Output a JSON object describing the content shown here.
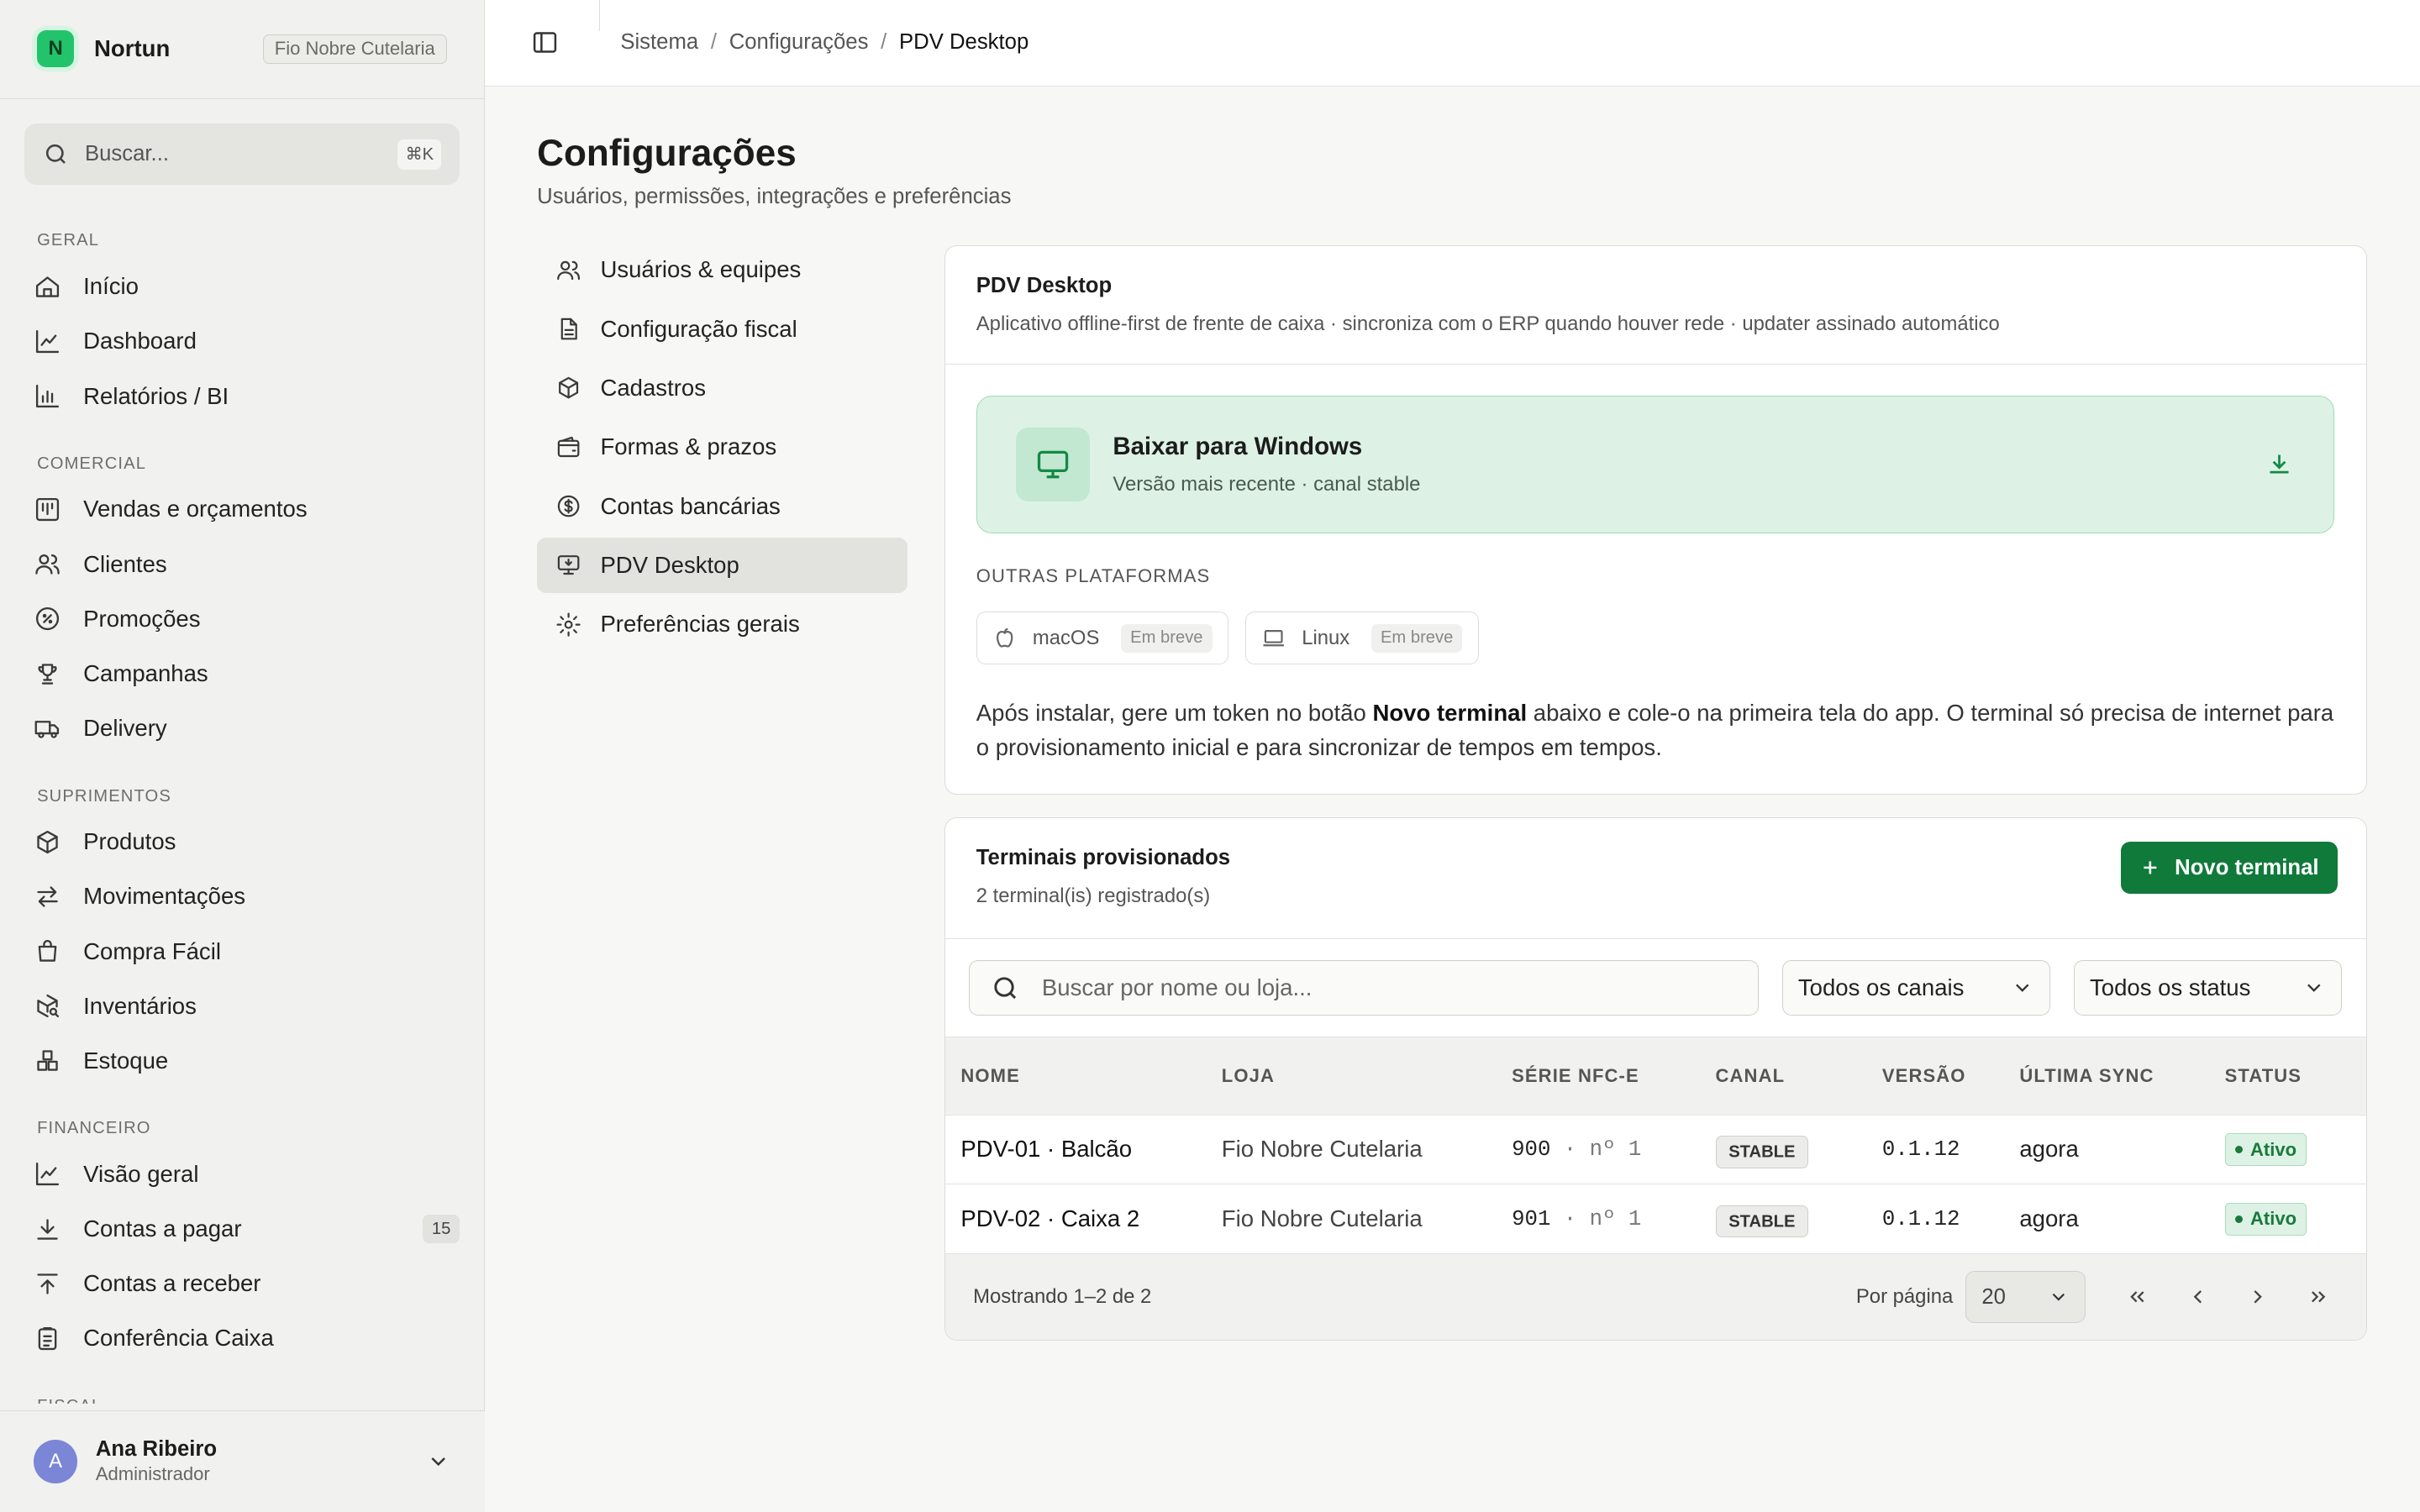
{
  "brand": {
    "name": "Nortun",
    "tenant": "Fio Nobre Cutelaria",
    "logo_letter": "N",
    "accent": "#23c36b"
  },
  "search": {
    "placeholder": "Buscar...",
    "shortcut": "⌘K"
  },
  "sidebar": {
    "sections": [
      {
        "title": "GERAL",
        "items": [
          {
            "label": "Início",
            "icon": "home-icon"
          },
          {
            "label": "Dashboard",
            "icon": "line-chart-icon"
          },
          {
            "label": "Relatórios / BI",
            "icon": "bar-chart-icon"
          }
        ]
      },
      {
        "title": "COMERCIAL",
        "items": [
          {
            "label": "Vendas e orçamentos",
            "icon": "board-icon"
          },
          {
            "label": "Clientes",
            "icon": "users-icon"
          },
          {
            "label": "Promoções",
            "icon": "discount-icon"
          },
          {
            "label": "Campanhas",
            "icon": "trophy-icon"
          },
          {
            "label": "Delivery",
            "icon": "truck-icon"
          }
        ]
      },
      {
        "title": "SUPRIMENTOS",
        "items": [
          {
            "label": "Produtos",
            "icon": "box-icon"
          },
          {
            "label": "Movimentações",
            "icon": "arrows-icon"
          },
          {
            "label": "Compra Fácil",
            "icon": "bag-icon"
          },
          {
            "label": "Inventários",
            "icon": "box-search-icon"
          },
          {
            "label": "Estoque",
            "icon": "boxes-icon"
          }
        ]
      },
      {
        "title": "FINANCEIRO",
        "items": [
          {
            "label": "Visão geral",
            "icon": "line-chart-icon"
          },
          {
            "label": "Contas a pagar",
            "icon": "download-icon",
            "badge": "15"
          },
          {
            "label": "Contas a receber",
            "icon": "upload-icon"
          },
          {
            "label": "Conferência Caixa",
            "icon": "clipboard-icon"
          }
        ]
      },
      {
        "title": "FISCAL",
        "items": []
      }
    ]
  },
  "user": {
    "initial": "A",
    "name": "Ana Ribeiro",
    "role": "Administrador"
  },
  "breadcrumb": [
    "Sistema",
    "Configurações",
    "PDV Desktop"
  ],
  "page": {
    "title": "Configurações",
    "subtitle": "Usuários, permissões, integrações e preferências"
  },
  "subnav": [
    {
      "label": "Usuários & equipes",
      "icon": "users-icon"
    },
    {
      "label": "Configuração fiscal",
      "icon": "file-icon"
    },
    {
      "label": "Cadastros",
      "icon": "cube-icon"
    },
    {
      "label": "Formas & prazos",
      "icon": "wallet-icon"
    },
    {
      "label": "Contas bancárias",
      "icon": "dollar-icon"
    },
    {
      "label": "PDV Desktop",
      "icon": "monitor-download-icon",
      "active": true
    },
    {
      "label": "Preferências gerais",
      "icon": "gear-icon"
    }
  ],
  "pdv": {
    "title": "PDV Desktop",
    "subtitle": "Aplicativo offline-first de frente de caixa · sincroniza com o ERP quando houver rede · updater assinado automático",
    "download": {
      "title": "Baixar para Windows",
      "subtitle": "Versão mais recente · canal stable"
    },
    "other_title": "OUTRAS PLATAFORMAS",
    "platforms": [
      {
        "name": "macOS",
        "status": "Em breve"
      },
      {
        "name": "Linux",
        "status": "Em breve"
      }
    ],
    "note_pre": "Após instalar, gere um token no botão ",
    "note_bold": "Novo terminal",
    "note_post": " abaixo e cole-o na primeira tela do app. O terminal só precisa de internet para o provisionamento inicial e para sincronizar de tempos em tempos."
  },
  "terminals": {
    "title": "Terminais provisionados",
    "count": "2 terminal(is) registrado(s)",
    "new_button": "Novo terminal",
    "search_placeholder": "Buscar por nome ou loja...",
    "channel_filter": "Todos os canais",
    "status_filter": "Todos os status",
    "columns": [
      "NOME",
      "LOJA",
      "SÉRIE NFC-E",
      "CANAL",
      "VERSÃO",
      "ÚLTIMA SYNC",
      "STATUS"
    ],
    "rows": [
      {
        "name": "PDV-01 · Balcão",
        "store": "Fio Nobre Cutelaria",
        "serie": "900",
        "numero": "nº 1",
        "channel": "STABLE",
        "version": "0.1.12",
        "sync": "agora",
        "status": "Ativo"
      },
      {
        "name": "PDV-02 · Caixa 2",
        "store": "Fio Nobre Cutelaria",
        "serie": "901",
        "numero": "nº 1",
        "channel": "STABLE",
        "version": "0.1.12",
        "sync": "agora",
        "status": "Ativo"
      }
    ],
    "showing": "Mostrando 1–2 de 2",
    "per_page_label": "Por página",
    "per_page": "20"
  }
}
